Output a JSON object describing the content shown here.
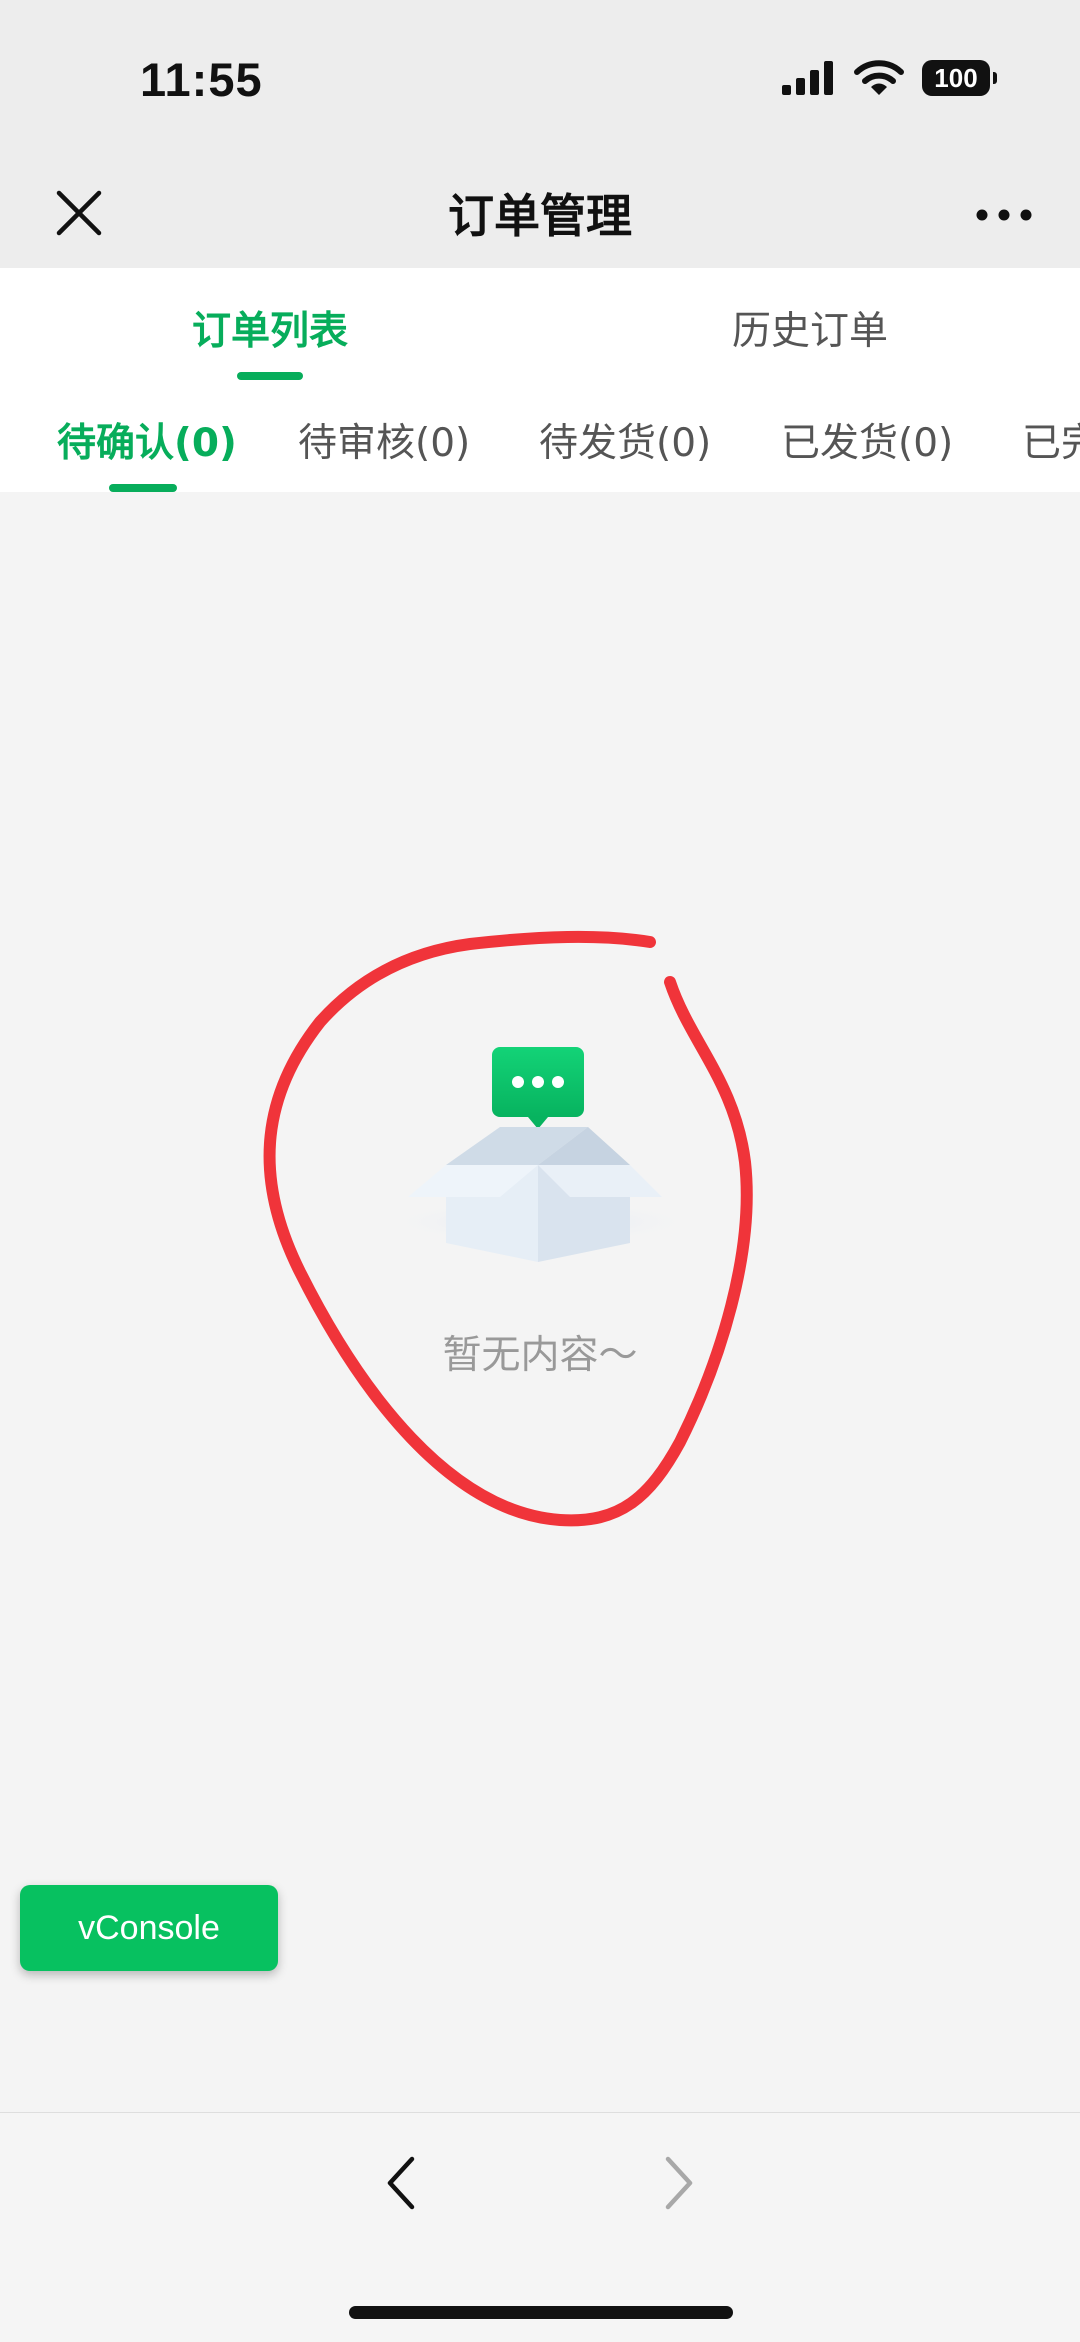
{
  "status_bar": {
    "time": "11:55",
    "battery": "100",
    "icons": [
      "signal-icon",
      "wifi-icon",
      "battery-icon"
    ]
  },
  "nav": {
    "title": "订单管理",
    "close_icon": "close-icon",
    "more_icon": "more-icon"
  },
  "main_tabs": [
    {
      "label": "订单列表",
      "active": true
    },
    {
      "label": "历史订单",
      "active": false
    }
  ],
  "sub_tabs": [
    {
      "label": "待确认(0)",
      "active": true
    },
    {
      "label": "待审核(0)",
      "active": false
    },
    {
      "label": "待发货(0)",
      "active": false
    },
    {
      "label": "已发货(0)",
      "active": false
    },
    {
      "label": "已完",
      "active": false
    }
  ],
  "empty_state": {
    "text": "暂无内容～",
    "icon": "empty-box-icon"
  },
  "vconsole": {
    "label": "vConsole"
  },
  "bottom_nav": {
    "back_icon": "chevron-left-icon",
    "forward_icon": "chevron-right-icon"
  },
  "colors": {
    "accent": "#07ad5b",
    "vconsole_bg": "#07c160",
    "annotation": "#f0343a",
    "background": "#f4f4f4"
  }
}
